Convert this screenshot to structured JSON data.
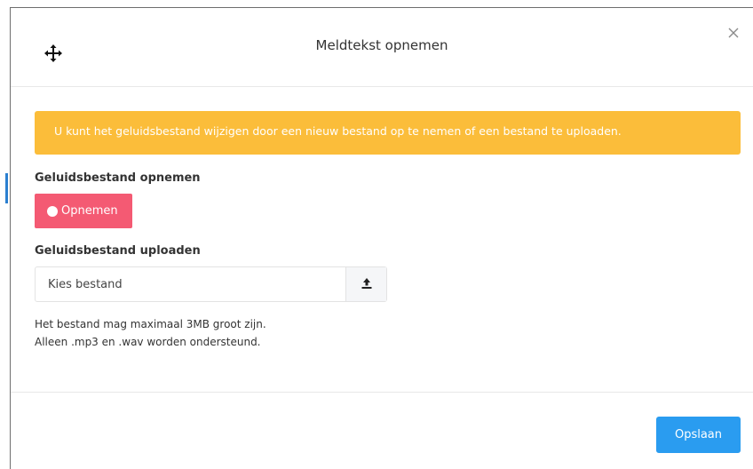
{
  "modal": {
    "title": "Meldtekst opnemen",
    "alert": "U kunt het geluidsbestand wijzigen door een nieuw bestand op te nemen of een bestand te uploaden.",
    "record_section_label": "Geluidsbestand opnemen",
    "record_button_label": "Opnemen",
    "upload_section_label": "Geluidsbestand uploaden",
    "file_input_label": "Kies bestand",
    "help_line_1": "Het bestand mag maximaal 3MB groot zijn.",
    "help_line_2": "Alleen .mp3 en .wav worden ondersteund.",
    "save_button_label": "Opslaan"
  },
  "icons": {
    "move": "move-icon",
    "close": "close-icon",
    "record": "record-dot-icon",
    "upload": "upload-icon"
  },
  "colors": {
    "alert_bg": "#fbbd3a",
    "record_button": "#f45a73",
    "save_button": "#2a9cf0"
  }
}
